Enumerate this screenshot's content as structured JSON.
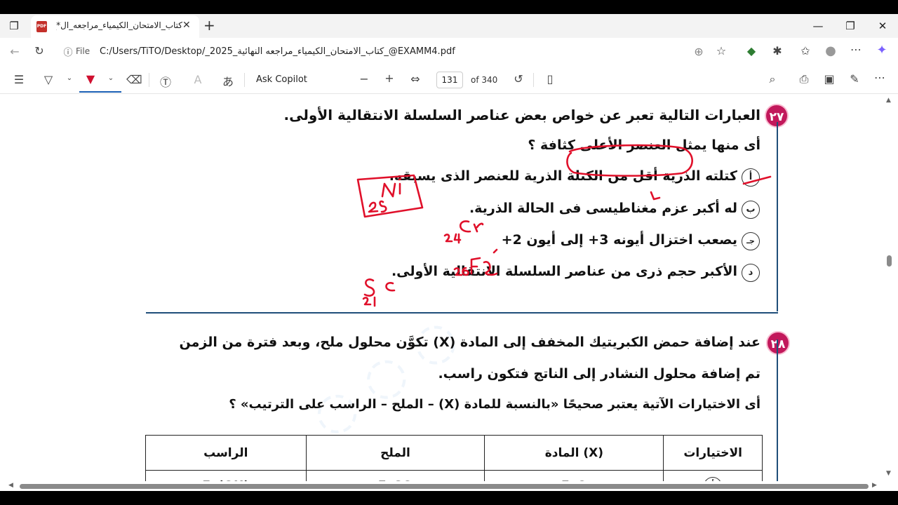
{
  "tab": {
    "title": "كتاب_الامتحان_الكيمياء_مراجعه_ال*_",
    "close_glyph": "✕",
    "pdf_badge": "PDF"
  },
  "address": {
    "file_label": "File",
    "url": "C:/Users/TiTO/Desktop/_2025_كتاب_الامتحان_الكيمياء_مراجعه النهائية_@EXAMM4.pdf"
  },
  "toolbar": {
    "ask_copilot": "Ask Copilot",
    "page_number": "131",
    "page_count": "of 340"
  },
  "document": {
    "q27": {
      "number": "٢٧",
      "stem": "العبارات التالية تعبر عن خواص بعض عناصر السلسلة الانتقالية الأولى.",
      "question": "أى منها يمثل العنصر الأعلى كثافة ؟",
      "options": [
        {
          "label": "أ",
          "text": "كتلته الذرية أقل من الكتلة الذرية للعنصر الذى يسبقه."
        },
        {
          "label": "ب",
          "text": "له أكبر عزم مغناطيسى فى الحالة الذرية."
        },
        {
          "label": "جـ",
          "text": "يصعب اختزال أيونه 3+ إلى أيون 2+"
        },
        {
          "label": "د",
          "text": "الأكبر حجم ذرى من عناصر السلسلة الانتقالية الأولى."
        }
      ]
    },
    "q28": {
      "number": "٢٨",
      "line1": "عند إضافة حمض الكبريتيك المخفف إلى المادة (X) تكوَّن محلول ملح، وبعد فترة من الزمن",
      "line2": "تم إضافة محلول النشادر إلى الناتج فتكون راسب.",
      "question": "أى الاختيارات الآتية يعتبر صحيحًا «بالنسبة للمادة (X) – الملح – الراسب على الترتيب» ؟",
      "table_headers": [
        "الاختيارات",
        "المادة (X)",
        "الملح",
        "الراسب"
      ],
      "table_rows": [
        [
          "أ",
          "FeO",
          "FeSO",
          "Fe(OH)"
        ]
      ]
    }
  },
  "colors": {
    "badge": "#c2185b",
    "ink": "#e0102a",
    "rule": "#1f4e79"
  }
}
